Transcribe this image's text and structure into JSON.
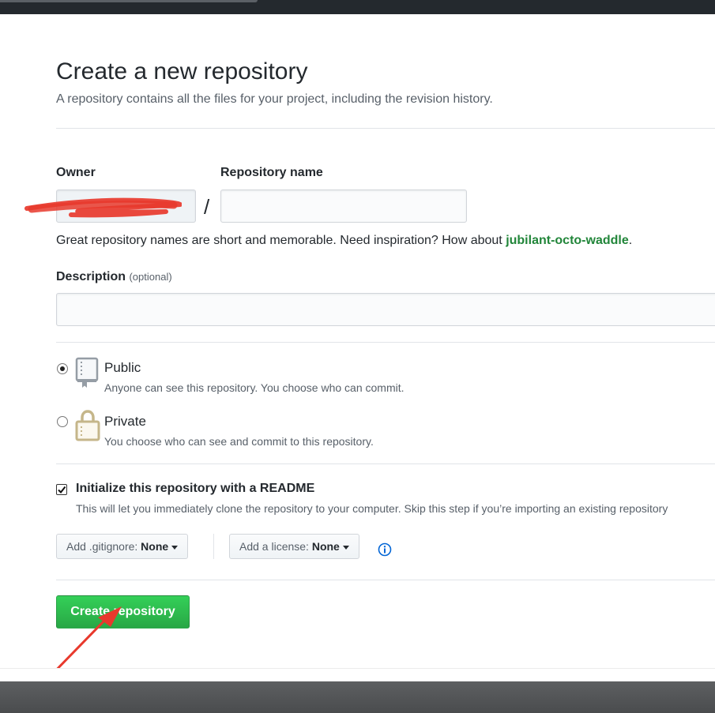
{
  "page": {
    "title": "Create a new repository",
    "subtitle": "A repository contains all the files for your project, including the revision history."
  },
  "form": {
    "owner_label": "Owner",
    "owner_value": "",
    "repo_label": "Repository name",
    "repo_value": "",
    "slash": "/",
    "hint_text": "Great repository names are short and memorable. Need inspiration? How about ",
    "hint_suggestion": "jubilant-octo-waddle",
    "hint_end": ".",
    "description_label": "Description",
    "description_optional": "(optional)",
    "description_value": ""
  },
  "visibility": {
    "selected": "public",
    "public": {
      "title": "Public",
      "desc": "Anyone can see this repository. You choose who can commit.",
      "icon": "repo-book-icon"
    },
    "private": {
      "title": "Private",
      "desc": "You choose who can see and commit to this repository.",
      "icon": "lock-icon"
    }
  },
  "init": {
    "checked": true,
    "title": "Initialize this repository with a README",
    "desc": "This will let you immediately clone the repository to your computer. Skip this step if you’re importing an existing repository"
  },
  "options": {
    "gitignore_label": "Add .gitignore: ",
    "gitignore_value": "None",
    "license_label": "Add a license: ",
    "license_value": "None",
    "info_icon": "info-icon"
  },
  "submit": {
    "label": "Create repository"
  },
  "colors": {
    "primary_button": "#28a745",
    "suggestion": "#22863a",
    "icon_gold": "#c5b68a",
    "icon_gray": "#959da5",
    "info": "#0366d6",
    "annotation": "#e8392d"
  }
}
